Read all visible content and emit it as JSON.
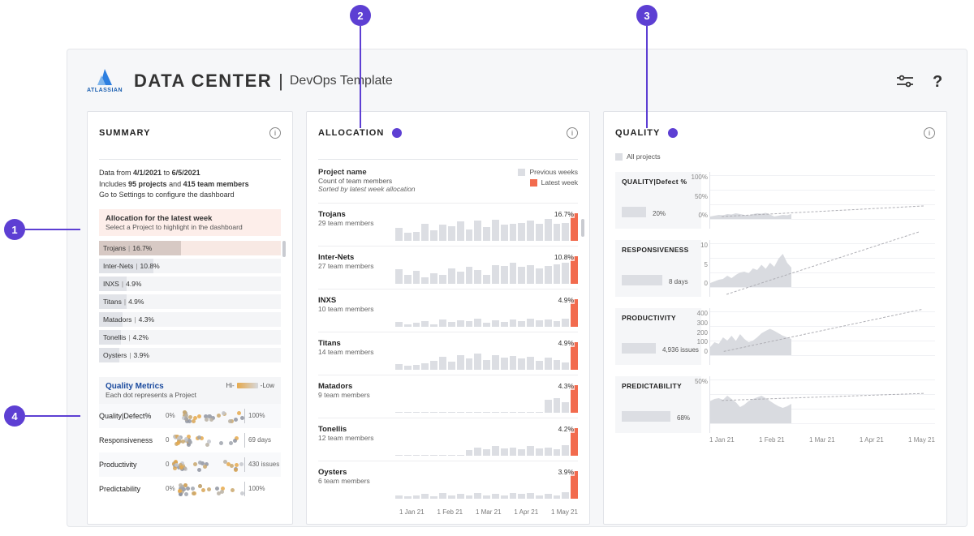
{
  "annotations": [
    "1",
    "2",
    "3",
    "4"
  ],
  "header": {
    "brand": "ATLASSIAN",
    "title": "DATA CENTER",
    "separator": "|",
    "subtitle": "DevOps Template"
  },
  "panels": {
    "summary": {
      "title": "SUMMARY",
      "date_prefix": "Data from ",
      "date_from": "4/1/2021",
      "date_mid": " to ",
      "date_to": "6/5/2021",
      "includes_prefix": "Includes ",
      "projects_count": "95 projects",
      "includes_mid": " and ",
      "members_count": "415 team members",
      "config_hint": "Go to Settings to configure the dashboard",
      "alloc_header": "Allocation for the latest week",
      "alloc_sub": "Select a Project to highlight in the dashboard",
      "projects": [
        {
          "name": "Trojans",
          "pct": "16.7%",
          "bar": 45,
          "highlight": true
        },
        {
          "name": "Inter-Nets",
          "pct": "10.8%",
          "bar": 30
        },
        {
          "name": "INXS",
          "pct": "4.9%",
          "bar": 15
        },
        {
          "name": "Titans",
          "pct": "4.9%",
          "bar": 15
        },
        {
          "name": "Matadors",
          "pct": "4.3%",
          "bar": 13
        },
        {
          "name": "Tonellis",
          "pct": "4.2%",
          "bar": 12
        },
        {
          "name": "Oysters",
          "pct": "3.9%",
          "bar": 11
        }
      ],
      "qm_title": "Quality Metrics",
      "qm_sub": "Each dot represents a Project",
      "qm_legend_hi": "Hi-",
      "qm_legend_lo": "-Low",
      "qm_rows": [
        {
          "label": "Quality|Defect%",
          "start": "0%",
          "end": "100%"
        },
        {
          "label": "Responsiveness",
          "start": "0",
          "end": "69 days"
        },
        {
          "label": "Productivity",
          "start": "0",
          "end": "430 issues"
        },
        {
          "label": "Predictability",
          "start": "0%",
          "end": "100%"
        }
      ]
    },
    "allocation": {
      "title": "ALLOCATION",
      "pname": "Project name",
      "psub": "Count of team members",
      "psort": "Sorted by latest week allocation",
      "legend_prev": "Previous weeks",
      "legend_latest": "Latest week",
      "axis": [
        "1 Jan 21",
        "1 Feb 21",
        "1 Mar 21",
        "1 Apr 21",
        "1 May 21"
      ],
      "projects": [
        {
          "name": "Trojans",
          "members": "29 team members",
          "pct": "16.7%",
          "bars": [
            45,
            28,
            30,
            60,
            35,
            55,
            50,
            68,
            40,
            70,
            48,
            72,
            55,
            60,
            62,
            70,
            58,
            75,
            60,
            62,
            95
          ]
        },
        {
          "name": "Inter-Nets",
          "members": "27 team members",
          "pct": "10.8%",
          "bars": [
            48,
            30,
            42,
            20,
            35,
            28,
            50,
            40,
            55,
            45,
            30,
            60,
            58,
            68,
            55,
            62,
            50,
            58,
            64,
            70,
            90
          ]
        },
        {
          "name": "INXS",
          "members": "10 team members",
          "pct": "4.9%",
          "bars": [
            5,
            3,
            4,
            6,
            3,
            8,
            5,
            7,
            6,
            9,
            4,
            7,
            5,
            8,
            6,
            9,
            7,
            8,
            6,
            9,
            30
          ]
        },
        {
          "name": "Titans",
          "members": "14 team members",
          "pct": "4.9%",
          "bars": [
            6,
            4,
            5,
            7,
            10,
            14,
            9,
            16,
            12,
            18,
            11,
            16,
            13,
            15,
            12,
            14,
            10,
            13,
            11,
            8,
            30
          ]
        },
        {
          "name": "Matadors",
          "members": "9 team members",
          "pct": "4.3%",
          "bars": [
            0,
            0,
            0,
            0,
            0,
            0,
            0,
            0,
            0,
            0,
            0,
            0,
            0,
            0,
            0,
            0,
            0,
            12,
            14,
            10,
            26
          ]
        },
        {
          "name": "Tonellis",
          "members": "12 team members",
          "pct": "4.2%",
          "bars": [
            0,
            0,
            0,
            0,
            0,
            0,
            0,
            0,
            5,
            8,
            6,
            9,
            7,
            8,
            6,
            9,
            7,
            8,
            6,
            10,
            26
          ]
        },
        {
          "name": "Oysters",
          "members": "6 team members",
          "pct": "3.9%",
          "bars": [
            3,
            2,
            3,
            4,
            2,
            5,
            3,
            4,
            3,
            5,
            3,
            4,
            3,
            5,
            4,
            5,
            3,
            4,
            3,
            6,
            24
          ]
        }
      ]
    },
    "quality": {
      "title": "QUALITY",
      "legend": "All projects",
      "axis": [
        "1 Jan 21",
        "1 Feb 21",
        "1 Mar 21",
        "1 Apr 21",
        "1 May 21"
      ],
      "sections": [
        {
          "title": "QUALITY|Defect %",
          "value": "20%",
          "bar": 30,
          "valx": 38,
          "ticks": [
            "100%",
            "50%",
            "0%"
          ],
          "trend_top": 68,
          "trend_deg": -3,
          "area": [
            6,
            8,
            10,
            9,
            12,
            11,
            14,
            12,
            10,
            9,
            12,
            14,
            13,
            15,
            11,
            6,
            8,
            10,
            9,
            12
          ]
        },
        {
          "title": "RESPONSIVENESS",
          "value": "8 days",
          "bar": 50,
          "valx": 58,
          "ticks": [
            "10",
            "5",
            "0"
          ],
          "trend_top": 40,
          "trend_deg": -18,
          "area": [
            10,
            14,
            18,
            20,
            28,
            22,
            30,
            36,
            38,
            34,
            46,
            42,
            55,
            45,
            60,
            50,
            70,
            82,
            60,
            48
          ]
        },
        {
          "title": "PRODUCTIVITY",
          "value": "4,936 issues",
          "bar": 42,
          "valx": 50,
          "ticks": [
            "400",
            "300",
            "200",
            "100",
            "0"
          ],
          "trend_top": 38,
          "trend_deg": -12,
          "area": [
            20,
            32,
            28,
            44,
            36,
            48,
            35,
            52,
            40,
            32,
            36,
            44,
            54,
            60,
            65,
            60,
            54,
            48,
            44,
            40
          ]
        },
        {
          "title": "PREDICTABILITY",
          "value": "68%",
          "bar": 60,
          "valx": 68,
          "ticks": [
            "50%",
            ""
          ],
          "trend_top": 36,
          "trend_deg": -2,
          "area": [
            55,
            60,
            62,
            58,
            68,
            60,
            52,
            40,
            46,
            55,
            60,
            64,
            68,
            62,
            55,
            48,
            42,
            38,
            42,
            48
          ]
        }
      ]
    }
  },
  "chart_data": {
    "allocation_bars": {
      "type": "bar",
      "note": "Weekly allocation per project; last bar is latest week (orange)",
      "x_axis": [
        "1 Jan 21",
        "1 Feb 21",
        "1 Mar 21",
        "1 Apr 21",
        "1 May 21"
      ],
      "series": [
        {
          "name": "Trojans",
          "latest_pct": 16.7
        },
        {
          "name": "Inter-Nets",
          "latest_pct": 10.8
        },
        {
          "name": "INXS",
          "latest_pct": 4.9
        },
        {
          "name": "Titans",
          "latest_pct": 4.9
        },
        {
          "name": "Matadors",
          "latest_pct": 4.3
        },
        {
          "name": "Tonellis",
          "latest_pct": 4.2
        },
        {
          "name": "Oysters",
          "latest_pct": 3.9
        }
      ]
    },
    "quality_trends": [
      {
        "type": "area",
        "title": "QUALITY|Defect %",
        "ylim": [
          0,
          100
        ],
        "summary_value": "20%"
      },
      {
        "type": "area",
        "title": "RESPONSIVENESS",
        "ylim": [
          0,
          10
        ],
        "summary_value": "8 days"
      },
      {
        "type": "area",
        "title": "PRODUCTIVITY",
        "ylim": [
          0,
          400
        ],
        "summary_value": "4,936 issues"
      },
      {
        "type": "area",
        "title": "PREDICTABILITY",
        "ylim": [
          0,
          100
        ],
        "summary_value": "68%"
      }
    ],
    "summary_dots": {
      "type": "scatter",
      "note": "Each dot = one project positioned on metric scale; color Hi→Low amber→gray",
      "metrics": [
        "Quality|Defect%",
        "Responsiveness",
        "Productivity",
        "Predictability"
      ]
    }
  }
}
